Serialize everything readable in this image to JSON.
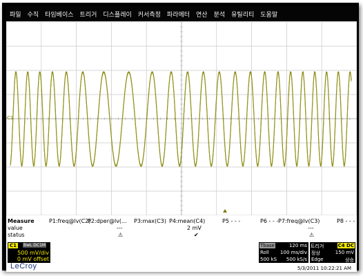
{
  "menu": [
    "파일",
    "수직",
    "타임베이스",
    "트리거",
    "디스플레이",
    "커서측정",
    "파라메터",
    "연산",
    "분석",
    "유틸리티",
    "도움말"
  ],
  "colors": {
    "trace": "#7b7b00",
    "channel": "#f4ea00",
    "grid": "#c8c8c8"
  },
  "waveform": {
    "channel_label": "C1"
  },
  "measure": {
    "title": "Measure",
    "row_value_label": "value",
    "row_status_label": "status",
    "params": [
      {
        "label": "P1:freq@lv(C2)",
        "value": "",
        "status": ""
      },
      {
        "label": "P2:dper@lv(...",
        "value": "---",
        "status": "⚠"
      },
      {
        "label": "P3:max(C3)",
        "value": "",
        "status": ""
      },
      {
        "label": "P4:mean(C4)",
        "value": "2 mV",
        "status": "✔"
      },
      {
        "label": "P5 - - -",
        "value": "",
        "status": ""
      },
      {
        "label": "P6 - - -",
        "value": "",
        "status": ""
      },
      {
        "label": "P7:freq@lv(C3)",
        "value": "---",
        "status": "⚠"
      },
      {
        "label": "P8 - - -",
        "value": "",
        "status": ""
      }
    ]
  },
  "channel": {
    "tag": "C1",
    "mode": "BwL  DC1M",
    "vdiv": "500 mV/div",
    "offset": "0 mV offset"
  },
  "timebase": {
    "title": "Tbase",
    "delay": "120 ms",
    "mode": "Roll",
    "tdiv": "100 ms/div",
    "samples": "500 kS",
    "rate": "500 kS/s"
  },
  "trigger": {
    "title": "트리거",
    "channel": "C4 DC",
    "mode": "정상",
    "level": "150 mV",
    "type": "Edge",
    "slope": "상승"
  },
  "brand": "LeCroy",
  "datetime": "5/3/2011 10:22:21 AM"
}
